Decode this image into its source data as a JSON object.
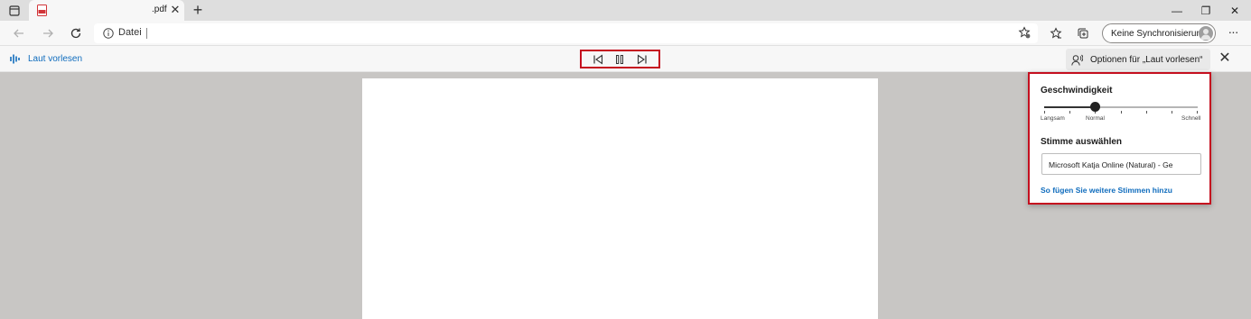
{
  "tab": {
    "title": ".pdf",
    "close_glyph": "✕",
    "icon": "pdf-file-icon"
  },
  "newtab_glyph": "+",
  "window": {
    "minimize": "—",
    "restore": "❐",
    "close": "✕"
  },
  "address": {
    "info_icon": "info-icon",
    "text": "Datei"
  },
  "sync": {
    "label": "Keine Synchronisierung"
  },
  "more_glyph": "···",
  "readaloud": {
    "label": "Laut vorlesen",
    "options_label": "Optionen für „Laut vorlesen“",
    "close_glyph": "✕"
  },
  "panel": {
    "speed_heading": "Geschwindigkeit",
    "speed_labels": {
      "slow": "Langsam",
      "normal": "Normal",
      "fast": "Schnell"
    },
    "speed_level": 0.33,
    "voice_heading": "Stimme auswählen",
    "voice_value": "Microsoft Katja Online (Natural) - Ge",
    "more_voices_link": "So fügen Sie weitere Stimmen hinzu"
  },
  "colors": {
    "accent": "#0f6cbd",
    "highlight": "#c50f1f",
    "background": "#c8c6c4"
  }
}
